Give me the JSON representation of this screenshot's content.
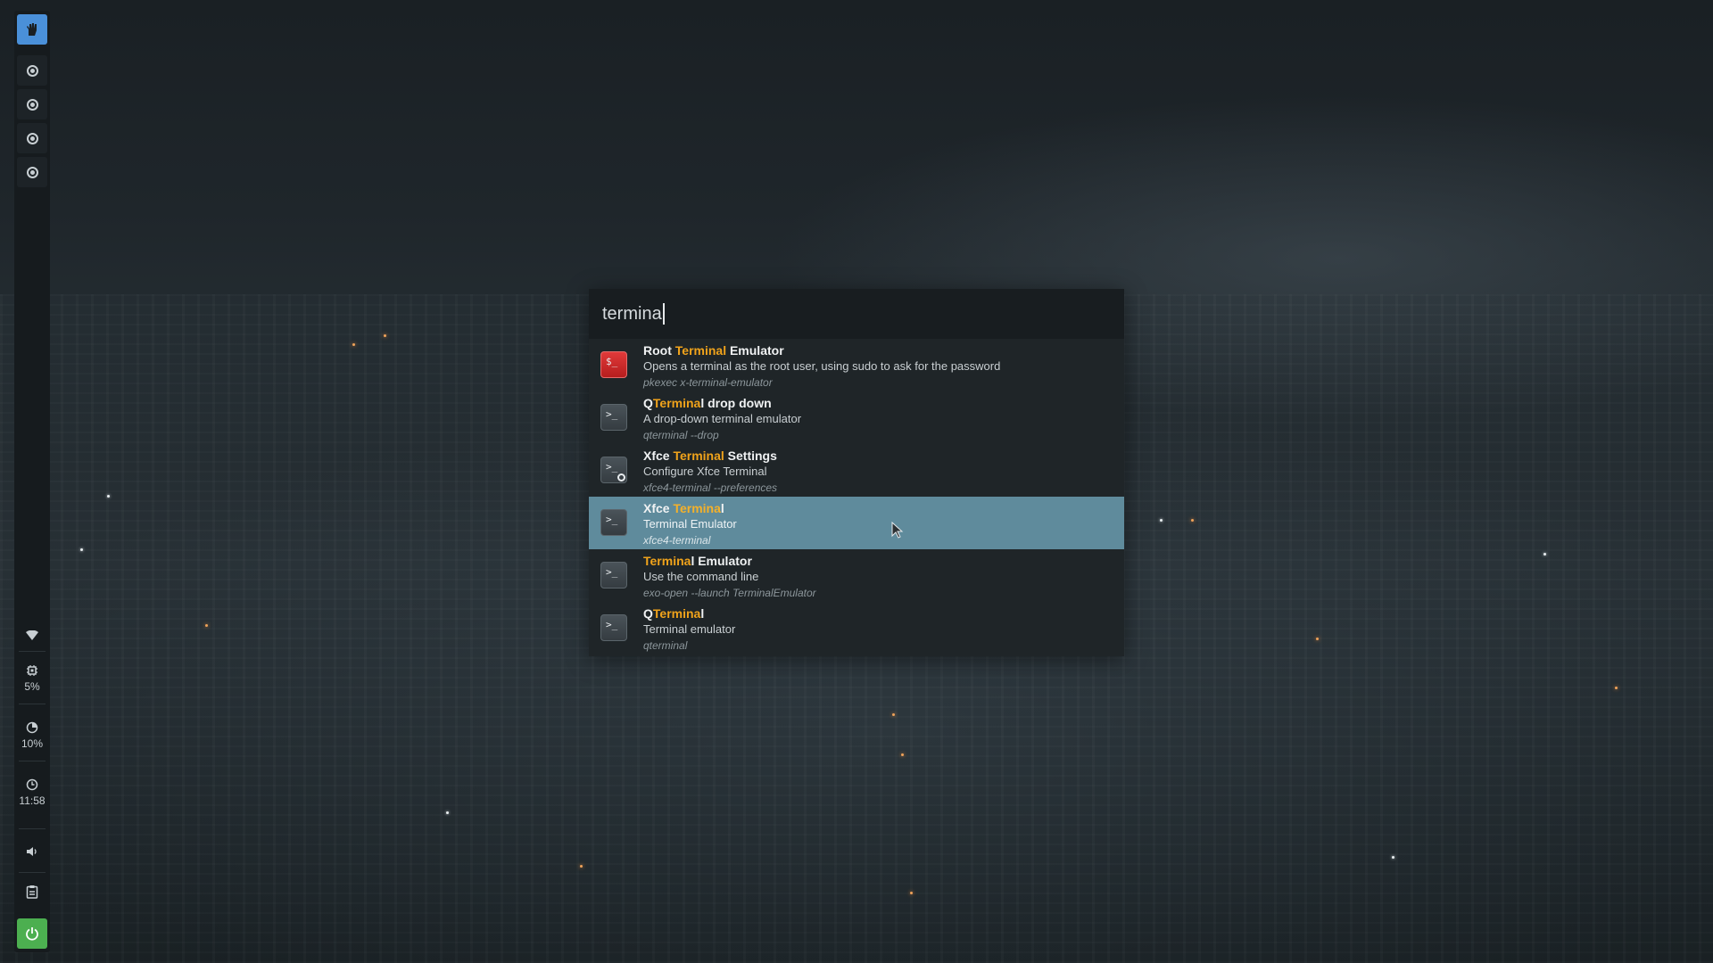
{
  "panel": {
    "launcher_icon": "launcher-icon",
    "workspaces": [
      "workspace-1",
      "workspace-2",
      "workspace-3",
      "workspace-4"
    ],
    "cpu": "5%",
    "memory": "10%",
    "clock": "11:58"
  },
  "launcher": {
    "query": "termina",
    "results": [
      {
        "pre": "Root ",
        "match": "Terminal",
        "post": " Emulator",
        "desc": "Opens a terminal as the root user, using sudo to ask for the password",
        "cmd": "pkexec x-terminal-emulator",
        "icon": "root-terminal-icon",
        "selected": false
      },
      {
        "pre": "Q",
        "match": "Termina",
        "post": "l drop down",
        "desc": "A drop-down terminal emulator",
        "cmd": "qterminal --drop",
        "icon": "terminal-icon",
        "selected": false
      },
      {
        "pre": "Xfce ",
        "match": "Terminal",
        "post": " Settings",
        "desc": "Configure Xfce Terminal",
        "cmd": "xfce4-terminal --preferences",
        "icon": "terminal-settings-icon",
        "selected": false
      },
      {
        "pre": "Xfce ",
        "match": "Termina",
        "post": "l",
        "desc": "Terminal Emulator",
        "cmd": "xfce4-terminal",
        "icon": "terminal-icon",
        "selected": true
      },
      {
        "pre": "",
        "match": "Termina",
        "post": "l Emulator",
        "desc": "Use the command line",
        "cmd": "exo-open --launch TerminalEmulator",
        "icon": "terminal-icon",
        "selected": false
      },
      {
        "pre": "Q",
        "match": "Termina",
        "post": "l",
        "desc": "Terminal emulator",
        "cmd": "qterminal",
        "icon": "terminal-icon",
        "selected": false
      }
    ]
  },
  "colors": {
    "highlight": "#f0a31b",
    "selection": "#5f8b9c",
    "power": "#4caf50",
    "launcher_button": "#4a90d9"
  }
}
